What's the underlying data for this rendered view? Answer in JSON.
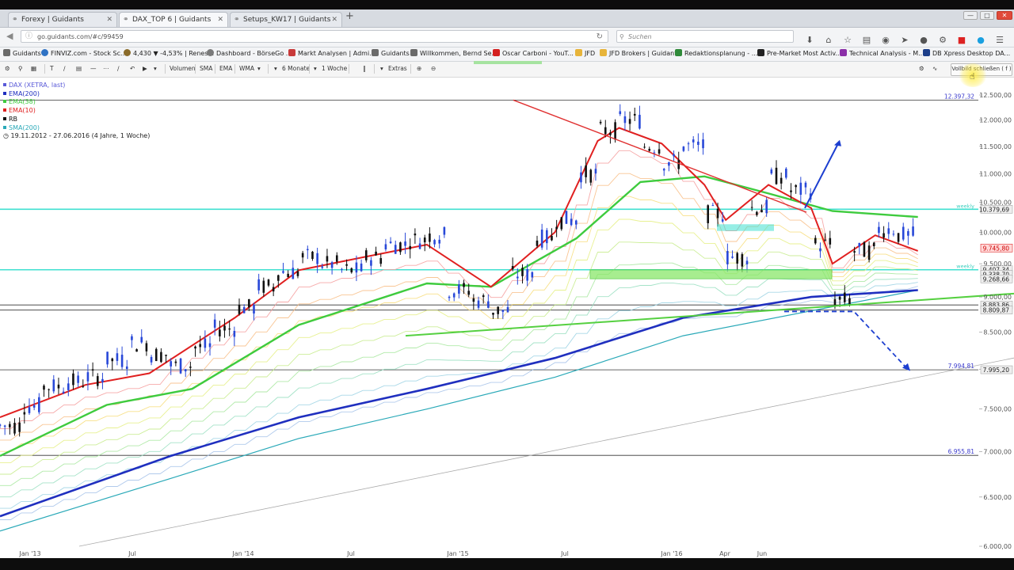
{
  "browser": {
    "tabs": [
      {
        "label": "Forexy | Guidants",
        "active": false
      },
      {
        "label": "DAX_TOP 6 | Guidants",
        "active": true
      },
      {
        "label": "Setups_KW17 | Guidants",
        "active": false
      }
    ],
    "url": "go.guidants.com/#c/99459",
    "search_placeholder": "Suchen",
    "bookmarks": [
      {
        "label": "Guidants",
        "color": "#6a6a6a"
      },
      {
        "label": "FINVIZ.com - Stock Sc...",
        "color": "#2f72c4"
      },
      {
        "label": "4,430 ▼ -4,53% | Renes...",
        "color": "#8a6b2a"
      },
      {
        "label": "Dashboard - BörseGo ...",
        "color": "#7a7a7a"
      },
      {
        "label": "Markt Analysen | Admi...",
        "color": "#c83a3a"
      },
      {
        "label": "Guidants",
        "color": "#6a6a6a"
      },
      {
        "label": "Willkommen, Bernd Se...",
        "color": "#6a6a6a"
      },
      {
        "label": "Oscar Carboni - YouT...",
        "color": "#d42020"
      },
      {
        "label": "JFD",
        "color": "#e7b43a"
      },
      {
        "label": "JFD Brokers | Guidants",
        "color": "#e7b43a"
      },
      {
        "label": "Redaktionsplanung - ...",
        "color": "#2f8a3a"
      },
      {
        "label": "Pre-Market Most Activ...",
        "color": "#222222"
      },
      {
        "label": "Technical Analysis - M...",
        "color": "#8b2fa8"
      },
      {
        "label": "DB Xpress Desktop DA...",
        "color": "#1d3f8a"
      }
    ]
  },
  "toolbar": {
    "volumen": "Volumen",
    "sma": "SMA",
    "ema": "EMA",
    "wma": "WMA",
    "zeitraum": "6 Monate",
    "intervall": "1 Woche",
    "extras": "Extras",
    "vollbild": "Vollbild schließen ( f )"
  },
  "legend": [
    {
      "label": "DAX (XETRA, last)",
      "color": "#5a5ad8"
    },
    {
      "label": "EMA(200)",
      "color": "#1f2fbf"
    },
    {
      "label": "EMA(38)",
      "color": "#3ecb3e"
    },
    {
      "label": "EMA(10)",
      "color": "#e02020"
    },
    {
      "label": "RB",
      "color": "#111111"
    },
    {
      "label": "SMA(200)",
      "color": "#2aa9b8"
    }
  ],
  "date_range": "19.11.2012 - 27.06.2016 (4 Jahre, 1 Woche)",
  "chart_data": {
    "type": "line",
    "instrument": "DAX (XETRA, last)",
    "y_scale": "log",
    "ylim": [
      6000,
      12650
    ],
    "y_ticks": [
      "12.500,00",
      "12.000,00",
      "11.500,00",
      "11.000,00",
      "10.500,00",
      "10.000,00",
      "9.500,00",
      "9.000,00",
      "8.500,00",
      "8.000,00",
      "7.500,00",
      "7.000,00",
      "6.500,00",
      "6.000,00"
    ],
    "x_ticks": [
      "Jan '13",
      "Jul",
      "Jan '14",
      "Jul",
      "Jan '15",
      "Jul",
      "Jan '16",
      "Apr",
      "Jun"
    ],
    "grid": false,
    "price": {
      "x": [
        "2012-11",
        "2013-01",
        "2013-03",
        "2013-05",
        "2013-07",
        "2013-09",
        "2013-11",
        "2014-01",
        "2014-03",
        "2014-05",
        "2014-07",
        "2014-08",
        "2014-10",
        "2014-12",
        "2015-01",
        "2015-02",
        "2015-03",
        "2015-04",
        "2015-05",
        "2015-06",
        "2015-07",
        "2015-08",
        "2015-09",
        "2015-10",
        "2015-11",
        "2015-12",
        "2016-01",
        "2016-02",
        "2016-03",
        "2016-04",
        "2016-05",
        "2016-06"
      ],
      "values": [
        7300,
        7780,
        7900,
        8350,
        8050,
        8550,
        9150,
        9600,
        9400,
        9800,
        9950,
        9100,
        8800,
        9900,
        10200,
        11000,
        11800,
        12000,
        11500,
        11200,
        11500,
        10300,
        9600,
        10400,
        10950,
        10700,
        9800,
        8950,
        9700,
        10050,
        9950,
        9400
      ]
    },
    "ema200": {
      "x": [
        "2012-11",
        "2013-07",
        "2014-01",
        "2014-07",
        "2015-01",
        "2015-07",
        "2016-01",
        "2016-06"
      ],
      "values": [
        6300,
        6950,
        7400,
        7750,
        8150,
        8700,
        9000,
        9100
      ]
    },
    "sma200": {
      "x": [
        "2012-11",
        "2013-07",
        "2014-01",
        "2014-07",
        "2015-01",
        "2015-07",
        "2016-01",
        "2016-06"
      ],
      "values": [
        6150,
        6700,
        7150,
        7500,
        7900,
        8450,
        8800,
        9100
      ]
    },
    "ema38": {
      "x": [
        "2012-11",
        "2013-04",
        "2013-08",
        "2014-01",
        "2014-07",
        "2014-10",
        "2015-02",
        "2015-05",
        "2015-08",
        "2015-11",
        "2016-02",
        "2016-06"
      ],
      "values": [
        6950,
        7550,
        7750,
        8600,
        9200,
        9150,
        9900,
        10850,
        10950,
        10650,
        10350,
        10250
      ]
    },
    "ema10": {
      "x": [
        "2012-11",
        "2013-03",
        "2013-06",
        "2013-10",
        "2014-01",
        "2014-04",
        "2014-07",
        "2014-10",
        "2015-01",
        "2015-03",
        "2015-04",
        "2015-06",
        "2015-08",
        "2015-09",
        "2015-11",
        "2016-01",
        "2016-02",
        "2016-04",
        "2016-06"
      ],
      "values": [
        7400,
        7800,
        7950,
        8700,
        9400,
        9600,
        9800,
        9150,
        10000,
        11600,
        11850,
        11550,
        10800,
        10200,
        10800,
        10400,
        9500,
        9950,
        9700
      ]
    },
    "annotations": [
      {
        "label": "12.397,32",
        "value": 12397.32,
        "line": "black"
      },
      {
        "label": "10.379,69",
        "value": 10379.69,
        "line": "cyan",
        "tag": "weekly"
      },
      {
        "label": "9.745,80",
        "value": 9745.8,
        "style": "red-tag"
      },
      {
        "label": "9.407,34",
        "value": 9407.34,
        "line": "cyan",
        "tag": "weekly"
      },
      {
        "label": "9.338,70",
        "value": 9338.7
      },
      {
        "label": "9.268,66",
        "value": 9268.66
      },
      {
        "label": "8.883,86",
        "value": 8883.86,
        "line": "black"
      },
      {
        "label": "8.809,87",
        "value": 8809.87,
        "line": "black"
      },
      {
        "label": "7.994,81",
        "value": 7994.81,
        "line": "black"
      },
      {
        "label": "7.995,20",
        "value": 7995.2
      },
      {
        "label": "6.955,81",
        "value": 6955.81,
        "line": "black"
      }
    ],
    "weekly_tag": "weekly"
  }
}
